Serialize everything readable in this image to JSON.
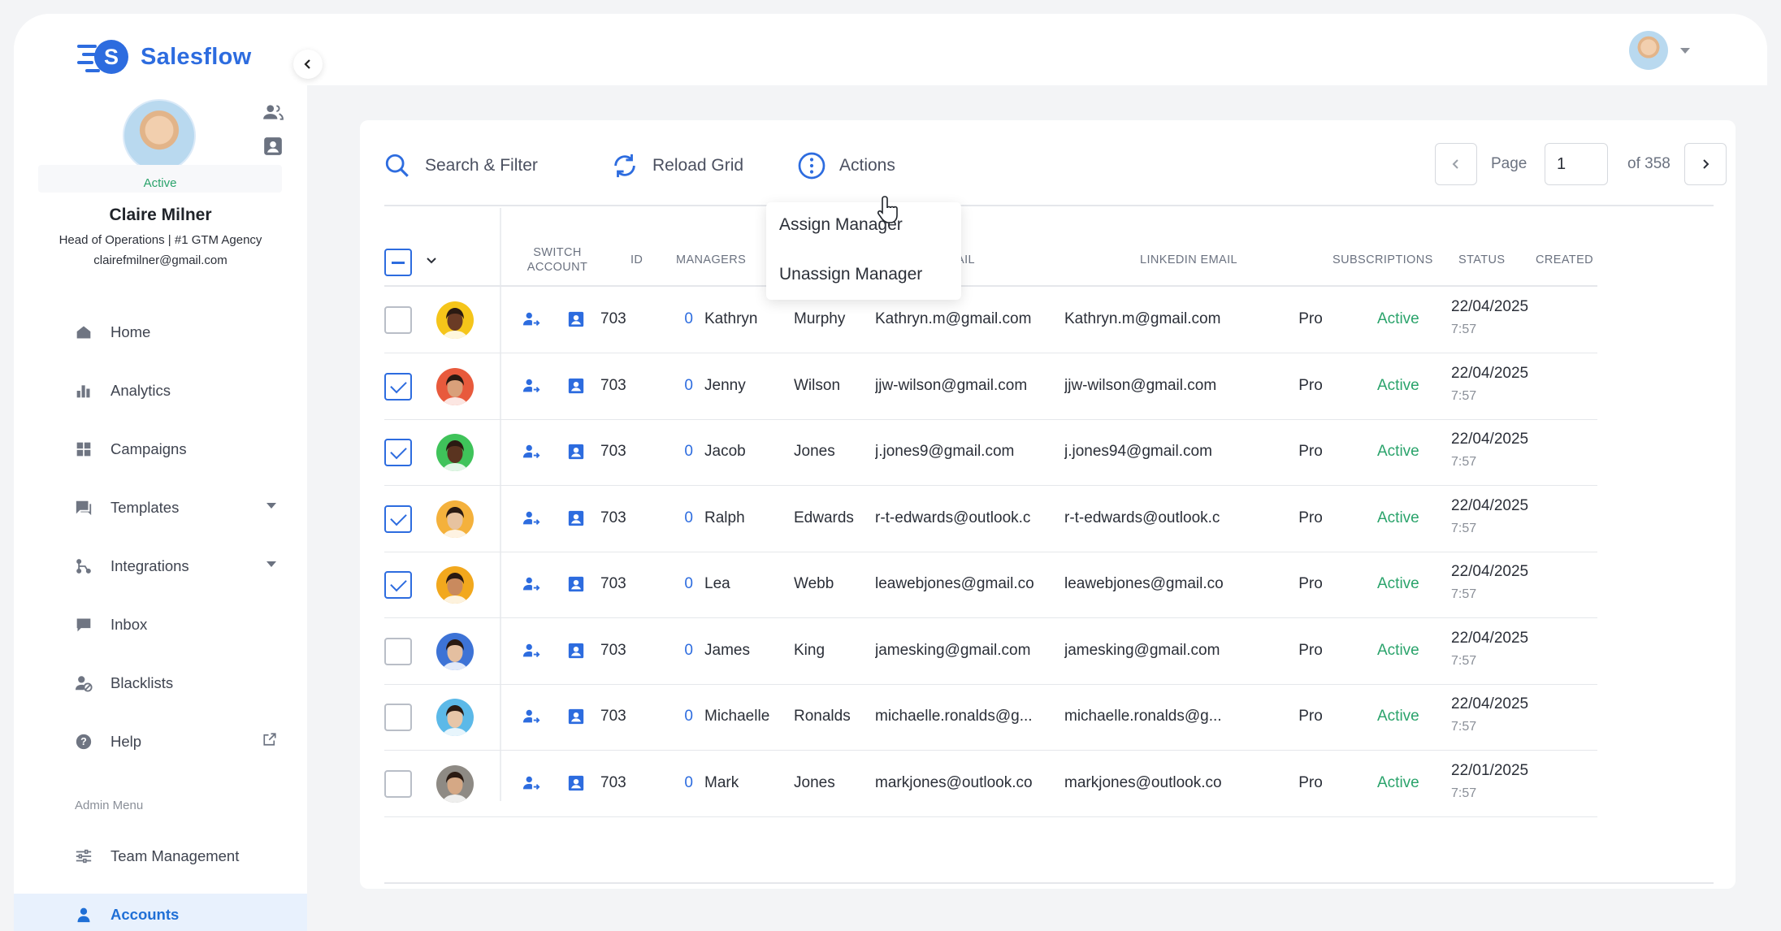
{
  "brand": {
    "name": "Salesflow"
  },
  "profile": {
    "status": "Active",
    "name": "Claire Milner",
    "role": "Head of Operations | #1 GTM Agency",
    "email": "clairefmilner@gmail.com"
  },
  "nav": {
    "items": [
      {
        "label": "Home",
        "icon": "home-icon"
      },
      {
        "label": "Analytics",
        "icon": "bar-chart-icon"
      },
      {
        "label": "Campaigns",
        "icon": "grid-icon"
      },
      {
        "label": "Templates",
        "icon": "chat-icon",
        "expandable": true
      },
      {
        "label": "Integrations",
        "icon": "integrations-icon",
        "expandable": true
      },
      {
        "label": "Inbox",
        "icon": "message-icon"
      },
      {
        "label": "Blacklists",
        "icon": "user-block-icon"
      },
      {
        "label": "Help",
        "icon": "help-icon",
        "external": true
      }
    ],
    "admin_label": "Admin Menu",
    "admin_items": [
      {
        "label": "Team Management",
        "icon": "sliders-icon"
      },
      {
        "label": "Accounts",
        "icon": "user-icon",
        "active": true
      }
    ]
  },
  "toolbar": {
    "search_label": "Search & Filter",
    "reload_label": "Reload Grid",
    "actions_label": "Actions",
    "actions_menu": [
      "Assign Manager",
      "Unassign Manager"
    ]
  },
  "pager": {
    "page_label": "Page",
    "current_page": "1",
    "total_label": "of 358"
  },
  "table": {
    "headers": {
      "switch_account": "SWITCH ACCOUNT",
      "id": "ID",
      "managers": "MANAGERS",
      "email": "AIL",
      "linkedin_email": "LINKEDIN EMAIL",
      "subscriptions": "SUBSCRIPTIONS",
      "status": "STATUS",
      "created": "CREATED"
    },
    "rows": [
      {
        "checked": false,
        "id": "703",
        "managers": "0",
        "first": "Kathryn",
        "last": "Murphy",
        "email": "Kathryn.m@gmail.com",
        "linkedin": "Kathryn.m@gmail.com",
        "sub": "Pro",
        "status": "Active",
        "date": "22/04/2025",
        "time": "7:57",
        "avatar_bg": "#f5c51a",
        "skin": "#6a3b25"
      },
      {
        "checked": true,
        "id": "703",
        "managers": "0",
        "first": "Jenny",
        "last": "Wilson",
        "email": "jjw-wilson@gmail.com",
        "linkedin": "jjw-wilson@gmail.com",
        "sub": "Pro",
        "status": "Active",
        "date": "22/04/2025",
        "time": "7:57",
        "avatar_bg": "#e85a3c",
        "skin": "#d9a07a"
      },
      {
        "checked": true,
        "id": "703",
        "managers": "0",
        "first": "Jacob",
        "last": "Jones",
        "email": "j.jones9@gmail.com",
        "linkedin": "j.jones94@gmail.com",
        "sub": "Pro",
        "status": "Active",
        "date": "22/04/2025",
        "time": "7:57",
        "avatar_bg": "#3fc35a",
        "skin": "#5a3420"
      },
      {
        "checked": true,
        "id": "703",
        "managers": "0",
        "first": "Ralph",
        "last": "Edwards",
        "email": "r-t-edwards@outlook.c",
        "linkedin": "r-t-edwards@outlook.c",
        "sub": "Pro",
        "status": "Active",
        "date": "22/04/2025",
        "time": "7:57",
        "avatar_bg": "#f4b13c",
        "skin": "#e7c3a0"
      },
      {
        "checked": true,
        "id": "703",
        "managers": "0",
        "first": "Lea",
        "last": "Webb",
        "email": "leawebjones@gmail.co",
        "linkedin": "leawebjones@gmail.co",
        "sub": "Pro",
        "status": "Active",
        "date": "22/04/2025",
        "time": "7:57",
        "avatar_bg": "#f2a81d",
        "skin": "#c98a5e"
      },
      {
        "checked": false,
        "id": "703",
        "managers": "0",
        "first": "James",
        "last": "King",
        "email": "jamesking@gmail.com",
        "linkedin": "jamesking@gmail.com",
        "sub": "Pro",
        "status": "Active",
        "date": "22/04/2025",
        "time": "7:57",
        "avatar_bg": "#3d73d6",
        "skin": "#e4bfa0"
      },
      {
        "checked": false,
        "id": "703",
        "managers": "0",
        "first": "Michaelle",
        "last": "Ronalds",
        "email": "michaelle.ronalds@g...",
        "linkedin": "michaelle.ronalds@g...",
        "sub": "Pro",
        "status": "Active",
        "date": "22/04/2025",
        "time": "7:57",
        "avatar_bg": "#5cb9e8",
        "skin": "#e7c6a8"
      },
      {
        "checked": false,
        "id": "703",
        "managers": "0",
        "first": "Mark",
        "last": "Jones",
        "email": "markjones@outlook.co",
        "linkedin": "markjones@outlook.co",
        "sub": "Pro",
        "status": "Active",
        "date": "22/01/2025",
        "time": "7:57",
        "avatar_bg": "#8e8a84",
        "skin": "#d5a885"
      }
    ]
  },
  "colors": {
    "accent": "#2d6cdf",
    "active": "#2aa36b"
  }
}
